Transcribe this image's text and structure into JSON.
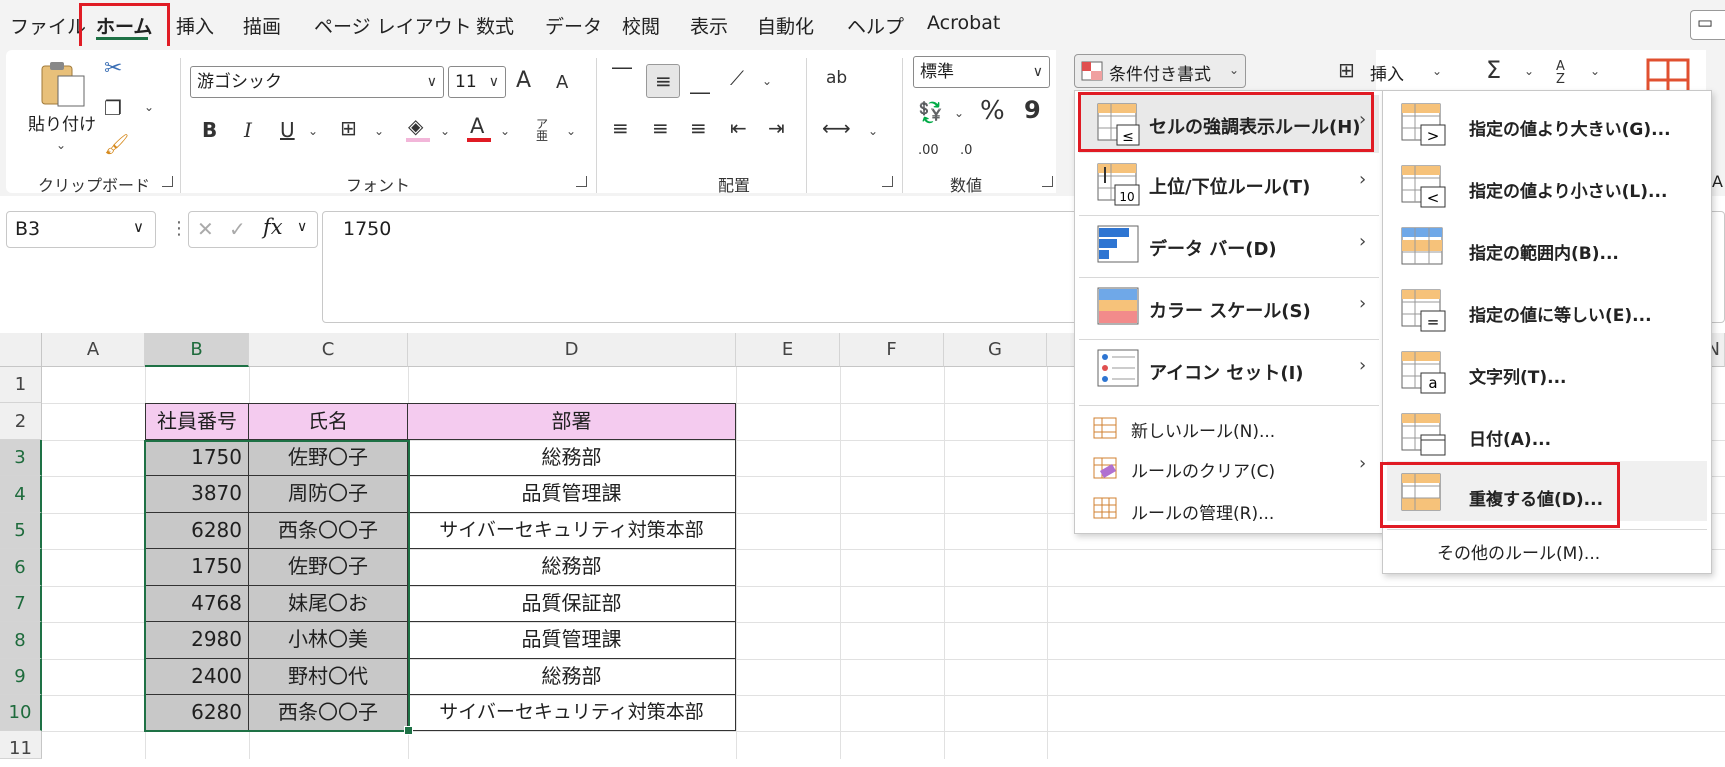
{
  "menu_tabs": [
    "ファイル",
    "ホーム",
    "挿入",
    "描画",
    "ページ レイアウト",
    "数式",
    "データ",
    "校閲",
    "表示",
    "自動化",
    "ヘルプ",
    "Acrobat"
  ],
  "ribbon": {
    "paste_label": "貼り付け",
    "clipboard_group": "クリップボード",
    "font_name": "游ゴシック",
    "font_size": "11",
    "font_group": "フォント",
    "alignment_group": "配置",
    "number_format": "標準",
    "number_group": "数値",
    "conditional_format": "条件付き書式",
    "insert": "挿入",
    "bold": "B",
    "italic": "I",
    "underline": "U",
    "grow_font": "A",
    "shrink_font": "A",
    "font_color": "A",
    "wrap_label": "ab",
    "percent": "%",
    "comma": "9",
    "decimal_more": ".00",
    "decimal_less": ".0",
    "autosum": "Σ",
    "sort": "A Z",
    "truncated_a": "A"
  },
  "formula_bar": {
    "cell_ref": "B3",
    "value": "1750",
    "fx": "fx"
  },
  "columns": [
    "A",
    "B",
    "C",
    "D",
    "E",
    "F",
    "G",
    "N"
  ],
  "rows": [
    "1",
    "2",
    "3",
    "4",
    "5",
    "6",
    "7",
    "8",
    "9",
    "10",
    "11"
  ],
  "table": {
    "headers": [
      "社員番号",
      "氏名",
      "部署"
    ],
    "rows": [
      [
        "1750",
        "佐野〇子",
        "総務部"
      ],
      [
        "3870",
        "周防〇子",
        "品質管理課"
      ],
      [
        "6280",
        "西条〇〇子",
        "サイバーセキュリティ対策本部"
      ],
      [
        "1750",
        "佐野〇子",
        "総務部"
      ],
      [
        "4768",
        "妹尾〇お",
        "品質保証部"
      ],
      [
        "2980",
        "小林〇美",
        "品質管理課"
      ],
      [
        "2400",
        "野村〇代",
        "総務部"
      ],
      [
        "6280",
        "西条〇〇子",
        "サイバーセキュリティ対策本部"
      ]
    ]
  },
  "cf_menu": {
    "items": [
      "セルの強調表示ルール(H)",
      "上位/下位ルール(T)",
      "データ バー(D)",
      "カラー スケール(S)",
      "アイコン セット(I)"
    ],
    "small_items": [
      "新しいルール(N)...",
      "ルールのクリア(C)",
      "ルールの管理(R)..."
    ],
    "icon_text_top_bottom": "10"
  },
  "highlight_submenu": {
    "items": [
      "指定の値より大きい(G)...",
      "指定の値より小さい(L)...",
      "指定の範囲内(B)...",
      "指定の値に等しい(E)...",
      "文字列(T)...",
      "日付(A)...",
      "重複する値(D)..."
    ],
    "more_rules": "その他のルール(M)...",
    "icon_glyphs": [
      ">",
      "<",
      "",
      "=",
      "a",
      "",
      ""
    ]
  },
  "colors": {
    "accent_green": "#1e7145",
    "highlight_red": "#e01b24",
    "header_fill": "#f4cbef",
    "selected_fill": "#c8c8c8",
    "icon_orange": "#f6c27a",
    "icon_blue": "#2e75d2",
    "icon_red": "#f28b8b"
  }
}
